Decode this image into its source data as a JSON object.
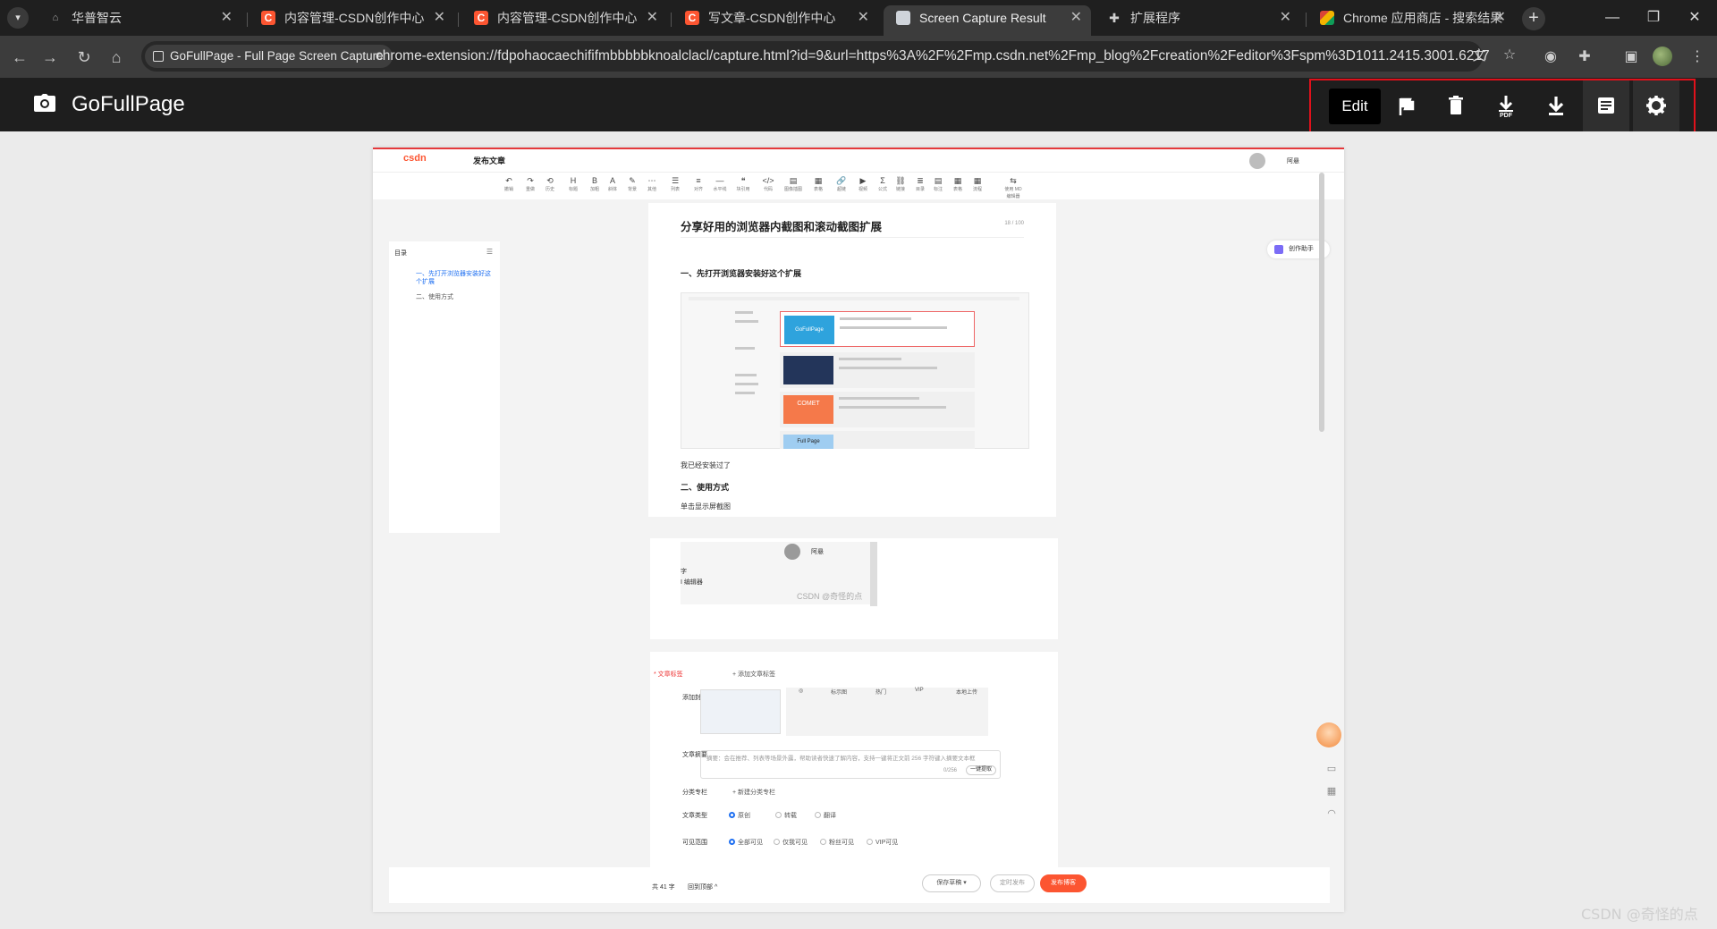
{
  "browser": {
    "tabs": [
      {
        "title": "华普智云",
        "favicon": "hua-icon"
      },
      {
        "title": "内容管理-CSDN创作中心",
        "favicon": "csdn-icon"
      },
      {
        "title": "内容管理-CSDN创作中心",
        "favicon": "csdn-icon"
      },
      {
        "title": "写文章-CSDN创作中心",
        "favicon": "csdn-icon"
      },
      {
        "title": "Screen Capture Result",
        "favicon": "camera-icon",
        "active": true
      },
      {
        "title": "扩展程序",
        "favicon": "puzzle-icon"
      },
      {
        "title": "Chrome 应用商店 - 搜索结果",
        "favicon": "chrome-store-icon"
      }
    ],
    "omnibox": {
      "chip_label": "GoFullPage - Full Page Screen Capture",
      "url": "chrome-extension://fdpohaocaechififmbbbbbknoalclacl/capture.html?id=9&url=https%3A%2F%2Fmp.csdn.net%2Fmp_blog%2Fcreation%2Feditor%3Fspm%3D1011.2415.3001.6217"
    }
  },
  "gfp": {
    "title": "GoFullPage",
    "edit_label": "Edit",
    "pdf_label": "PDF"
  },
  "editor": {
    "logo": "csdn",
    "publish_title": "发布文章",
    "user_name": "阿悬",
    "toolbar": [
      "撤销",
      "重做",
      "历史",
      "标题",
      "加粗",
      "斜体",
      "背景",
      "其他",
      "列表",
      "对齐",
      "水平线",
      "块引用",
      "代码",
      "图像插图",
      "表格",
      "超链",
      "视频",
      "公式",
      "链接",
      "目录",
      "标注",
      "表格",
      "流程",
      "使用 MD 编辑器"
    ],
    "toc_title": "目录",
    "toc_items": [
      "一、先打开浏览器安装好这个扩展",
      "二、使用方式"
    ],
    "doc_title": "分享好用的浏览器内截图和滚动截图扩展",
    "doc_count": "18 / 100",
    "h1": "一、先打开浏览器安装好这个扩展",
    "p1": "我已经安装过了",
    "h2": "二、使用方式",
    "p2": "单击显示屏截图",
    "embedded_user": "阿悬",
    "embedded_a": "字",
    "embedded_b": "I 编辑器",
    "embedded_wm": "CSDN @奇怪的点",
    "assistant": "创作助手",
    "mini_labels": [
      "GoFullPage",
      "COMET",
      "Full Page"
    ]
  },
  "settings": {
    "tags_label": "* 文章标签",
    "tags_value": "+ 添加文章标签",
    "cover_label": "添加封面",
    "cover_tabs": [
      "◎",
      "标示图",
      "热门",
      "VIP",
      "本地上传"
    ],
    "summary_label": "文章摘要",
    "summary_placeholder": "摘要：会在推荐、列表等场景外露，帮助读者快速了解内容，支持一键将正文前 256 字符键入摘要文本框",
    "summary_count": "0/256",
    "summary_btn": "一键提取",
    "column_label": "分类专栏",
    "column_value": "+ 新建分类专栏",
    "type_label": "文章类型",
    "type_options": [
      "原创",
      "转载",
      "翻译"
    ],
    "visibility_label": "可见范围",
    "visibility_options": [
      "全部可见",
      "仅我可见",
      "粉丝可见",
      "VIP可见"
    ]
  },
  "bottom": {
    "word_count": "共 41 字",
    "back_top": "回到顶部 ^",
    "save_draft": "保存草稿 ▾",
    "schedule": "定时发布",
    "publish": "发布博客"
  },
  "watermark": "CSDN @奇怪的点",
  "colors": {
    "csdn_red": "#fc5531",
    "highlight": "#e0111b",
    "blue": "#1e6ff1"
  }
}
